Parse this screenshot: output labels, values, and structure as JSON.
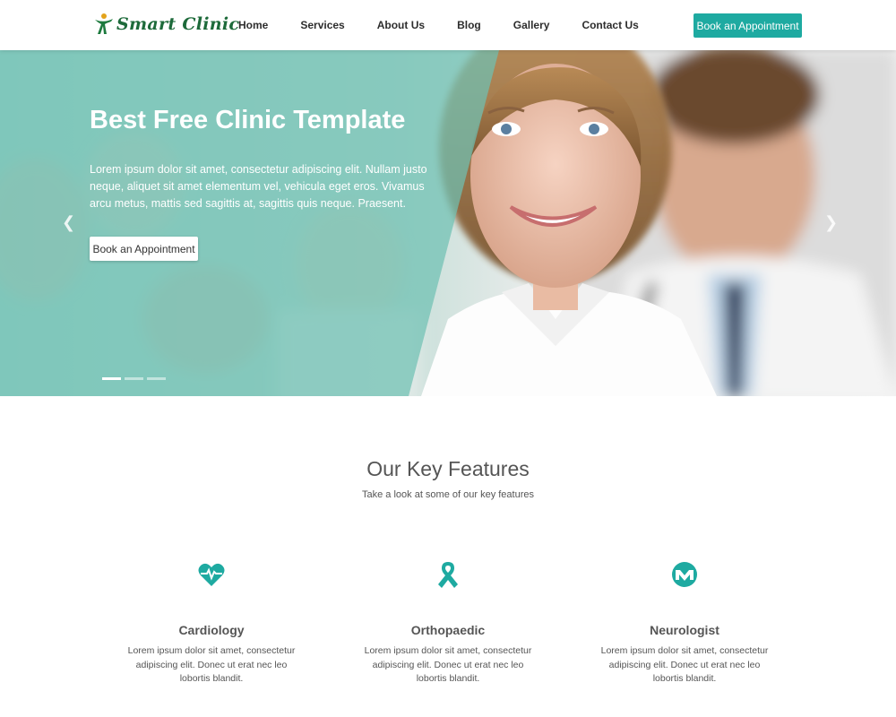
{
  "header": {
    "logo_text": "Smart Clinic",
    "nav": [
      "Home",
      "Services",
      "About Us",
      "Blog",
      "Gallery",
      "Contact Us"
    ],
    "cta": "Book an Appointment"
  },
  "hero": {
    "title": "Best Free Clinic Template",
    "text": "Lorem ipsum dolor sit amet, consectetur adipiscing elit. Nullam justo neque, aliquet sit amet elementum vel, vehicula eget eros. Vivamus arcu metus, mattis sed sagittis at, sagittis quis neque. Praesent.",
    "button": "Book an Appointment",
    "prev_icon": "chevron-left-icon",
    "next_icon": "chevron-right-icon",
    "slides": 3,
    "active_slide": 1
  },
  "features": {
    "title": "Our Key Features",
    "subtitle": "Take a look at some of our key features",
    "items": [
      {
        "name": "Cardiology",
        "icon": "heartbeat-icon",
        "desc": "Lorem ipsum dolor sit amet, consectetur adipiscing elit. Donec ut erat nec leo lobortis blandit."
      },
      {
        "name": "Orthopaedic",
        "icon": "ribbon-icon",
        "desc": "Lorem ipsum dolor sit amet, consectetur adipiscing elit. Donec ut erat nec leo lobortis blandit."
      },
      {
        "name": "Neurologist",
        "icon": "brain-m-icon",
        "desc": "Lorem ipsum dolor sit amet, consectetur adipiscing elit. Donec ut erat nec leo lobortis blandit."
      }
    ]
  },
  "colors": {
    "accent": "#1eaaa1",
    "hero_overlay": "#7fc9bd",
    "logo": "#1d6a3a"
  }
}
